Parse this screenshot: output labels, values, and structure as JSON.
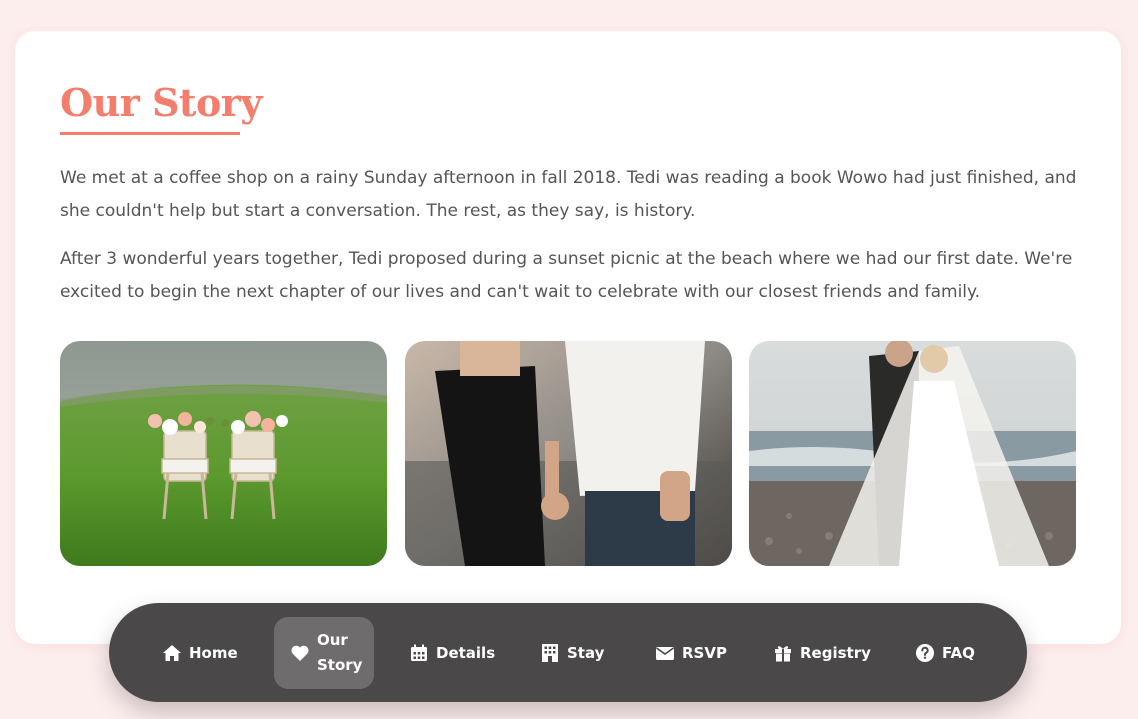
{
  "section": {
    "title": "Our Story",
    "paragraphs": [
      "We met at a coffee shop on a rainy Sunday afternoon in fall 2018. Tedi was reading a book Wowo had just finished, and she couldn't help but start a conversation. The rest, as they say, is history.",
      "After 3 wonderful years together, Tedi proposed during a sunset picnic at the beach where we had our first date. We're excited to begin the next chapter of our lives and can't wait to celebrate with our closest friends and family."
    ]
  },
  "photos": [
    {
      "icon": "chairs-on-lawn-photo"
    },
    {
      "icon": "couple-holding-hands-photo"
    },
    {
      "icon": "bride-and-groom-beach-photo"
    }
  ],
  "nav": {
    "items": [
      {
        "label": "Home",
        "icon": "home-icon"
      },
      {
        "label": "Our Story",
        "icon": "heart-icon",
        "active": true
      },
      {
        "label": "Details",
        "icon": "calendar-icon"
      },
      {
        "label": "Stay",
        "icon": "hotel-icon"
      },
      {
        "label": "RSVP",
        "icon": "envelope-icon"
      },
      {
        "label": "Registry",
        "icon": "gift-icon"
      },
      {
        "label": "FAQ",
        "icon": "question-icon"
      }
    ]
  },
  "colors": {
    "accent": "#f47d6b",
    "background": "#fdeeee",
    "nav_bg": "#4a4848",
    "nav_active": "#6e6c6c",
    "text": "#555555"
  }
}
